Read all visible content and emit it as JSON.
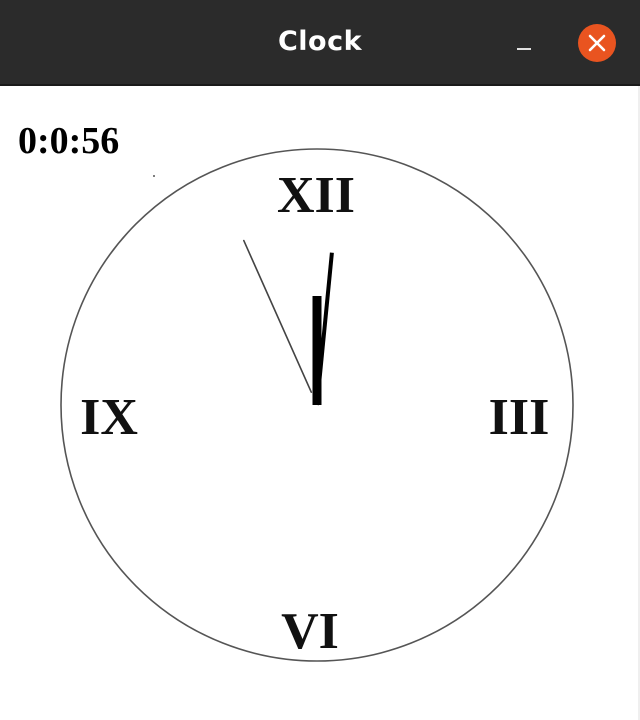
{
  "window": {
    "title": "Clock"
  },
  "titlebar_buttons": {
    "minimize_icon": "minimize-icon",
    "close_icon": "close-icon",
    "close_color": "#e95420"
  },
  "clock": {
    "digital_time": "0:0:56",
    "numerals": {
      "twelve": "XII",
      "three": "III",
      "six": "VI",
      "nine": "IX"
    },
    "hours": 0,
    "minutes": 0,
    "seconds": 56
  }
}
